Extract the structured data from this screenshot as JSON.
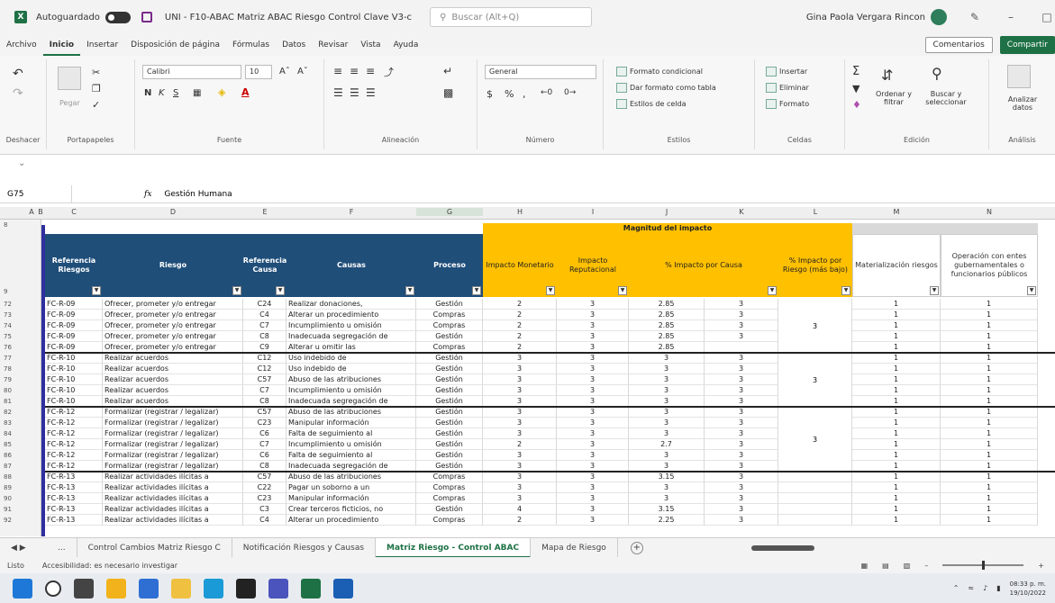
{
  "window": {
    "autosave_label": "Autoguardado",
    "doc_title": "UNI - F10-ABAC Matriz ABAC Riesgo Control Clave V3-c",
    "search_placeholder": "Buscar (Alt+Q)",
    "user_name": "Gina Paola Vergara Rincon"
  },
  "menu": {
    "tabs": [
      "Archivo",
      "Inicio",
      "Insertar",
      "Disposición de página",
      "Fórmulas",
      "Datos",
      "Revisar",
      "Vista",
      "Ayuda"
    ],
    "comments_label": "Comentarios",
    "share_label": "Compartir"
  },
  "ribbon": {
    "undo_label": "Deshacer",
    "clipboard_label": "Portapapeles",
    "paste_label": "Pegar",
    "font_name": "Calibri",
    "font_size": "10",
    "font_label": "Fuente",
    "alignment_label": "Alineación",
    "number_format": "General",
    "number_label": "Número",
    "cond_format": "Formato condicional",
    "format_table": "Dar formato como tabla",
    "cell_styles": "Estilos de celda",
    "styles_label": "Estilos",
    "insert": "Insertar",
    "delete": "Eliminar",
    "format": "Formato",
    "cells_label": "Celdas",
    "sort_filter": "Ordenar y filtrar",
    "find_select": "Buscar y seleccionar",
    "editing_label": "Edición",
    "analyze_data": "Analizar datos",
    "analysis_label": "Análisis"
  },
  "formula_bar": {
    "name_box": "G75",
    "fx": "fx",
    "value": "Gestión Humana"
  },
  "columns": [
    "A",
    "B",
    "C",
    "D",
    "E",
    "F",
    "G",
    "H",
    "I",
    "J",
    "K",
    "L",
    "M",
    "N"
  ],
  "headers": {
    "group_magnitud": "Magnitud del impacto",
    "ref_riesgo": "Referencia Riesgos",
    "riesgo": "Riesgo",
    "ref_causa": "Referencia Causa",
    "causas": "Causas",
    "proceso": "Proceso",
    "impacto_monetario": "Impacto Monetario",
    "impacto_reputacional": "Impacto Reputacional",
    "pct_impacto_causa": "% Impacto por Causa",
    "pct_impacto_riesgo": "% Impacto por Riesgo (más bajo)",
    "materializacion": "Materialización riesgos",
    "operacion_entes": "Operación con entes gubernamentales o funcionarios públicos",
    "header_row_num": "9"
  },
  "rows": [
    {
      "n": "72",
      "ref": "FC-R-09",
      "riesgo": "Ofrecer, prometer y/o entregar",
      "rc": "C24",
      "causa": "Realizar donaciones,",
      "proc": "Gestión",
      "im": "2",
      "ir": "3",
      "pc": "2.85",
      "k": "3",
      "m": "1",
      "o": "1"
    },
    {
      "n": "73",
      "ref": "FC-R-09",
      "riesgo": "Ofrecer, prometer y/o entregar",
      "rc": "C4",
      "causa": "Alterar un procedimiento",
      "proc": "Compras",
      "im": "2",
      "ir": "3",
      "pc": "2.85",
      "k": "3",
      "m": "1",
      "o": "1"
    },
    {
      "n": "74",
      "ref": "FC-R-09",
      "riesgo": "Ofrecer, prometer y/o entregar",
      "rc": "C7",
      "causa": "Incumplimiento u omisión",
      "proc": "Compras",
      "im": "2",
      "ir": "3",
      "pc": "2.85",
      "k": "3",
      "m": "1",
      "o": "1"
    },
    {
      "n": "75",
      "ref": "FC-R-09",
      "riesgo": "Ofrecer, prometer y/o entregar",
      "rc": "C8",
      "causa": "Inadecuada segregación de",
      "proc": "Gestión",
      "im": "2",
      "ir": "3",
      "pc": "2.85",
      "k": "3",
      "m": "1",
      "o": "1"
    },
    {
      "n": "76",
      "ref": "FC-R-09",
      "riesgo": "Ofrecer, prometer y/o entregar",
      "rc": "C9",
      "causa": "Alterar u omitir las",
      "proc": "Compras",
      "im": "2",
      "ir": "3",
      "pc": "2.85",
      "k": "",
      "m": "1",
      "o": "1"
    },
    {
      "n": "77",
      "ref": "FC-R-10",
      "riesgo": "Realizar acuerdos",
      "rc": "C12",
      "causa": "Uso indebido de",
      "proc": "Gestión",
      "im": "3",
      "ir": "3",
      "pc": "3",
      "k": "3",
      "m": "1",
      "o": "1"
    },
    {
      "n": "78",
      "ref": "FC-R-10",
      "riesgo": "Realizar acuerdos",
      "rc": "C12",
      "causa": "Uso indebido de",
      "proc": "Gestión",
      "im": "3",
      "ir": "3",
      "pc": "3",
      "k": "3",
      "m": "1",
      "o": "1"
    },
    {
      "n": "79",
      "ref": "FC-R-10",
      "riesgo": "Realizar acuerdos",
      "rc": "C57",
      "causa": "Abuso de las atribuciones",
      "proc": "Gestión",
      "im": "3",
      "ir": "3",
      "pc": "3",
      "k": "3",
      "m": "1",
      "o": "1"
    },
    {
      "n": "80",
      "ref": "FC-R-10",
      "riesgo": "Realizar acuerdos",
      "rc": "C7",
      "causa": "Incumplimiento u omisión",
      "proc": "Gestión",
      "im": "3",
      "ir": "3",
      "pc": "3",
      "k": "3",
      "m": "1",
      "o": "1"
    },
    {
      "n": "81",
      "ref": "FC-R-10",
      "riesgo": "Realizar acuerdos",
      "rc": "C8",
      "causa": "Inadecuada segregación de",
      "proc": "Gestión",
      "im": "3",
      "ir": "3",
      "pc": "3",
      "k": "3",
      "m": "1",
      "o": "1"
    },
    {
      "n": "82",
      "ref": "FC-R-12",
      "riesgo": "Formalizar (registrar / legalizar)",
      "rc": "C57",
      "causa": "Abuso de las atribuciones",
      "proc": "Gestión",
      "im": "3",
      "ir": "3",
      "pc": "3",
      "k": "3",
      "m": "1",
      "o": "1"
    },
    {
      "n": "83",
      "ref": "FC-R-12",
      "riesgo": "Formalizar (registrar / legalizar)",
      "rc": "C23",
      "causa": "Manipular información",
      "proc": "Gestión",
      "im": "3",
      "ir": "3",
      "pc": "3",
      "k": "3",
      "m": "1",
      "o": "1"
    },
    {
      "n": "84",
      "ref": "FC-R-12",
      "riesgo": "Formalizar (registrar / legalizar)",
      "rc": "C6",
      "causa": "Falta de seguimiento al",
      "proc": "Gestión",
      "im": "3",
      "ir": "3",
      "pc": "3",
      "k": "3",
      "m": "1",
      "o": "1"
    },
    {
      "n": "85",
      "ref": "FC-R-12",
      "riesgo": "Formalizar (registrar / legalizar)",
      "rc": "C7",
      "causa": "Incumplimiento u omisión",
      "proc": "Gestión",
      "im": "2",
      "ir": "3",
      "pc": "2.7",
      "k": "3",
      "m": "1",
      "o": "1"
    },
    {
      "n": "86",
      "ref": "FC-R-12",
      "riesgo": "Formalizar (registrar / legalizar)",
      "rc": "C6",
      "causa": "Falta de seguimiento al",
      "proc": "Gestión",
      "im": "3",
      "ir": "3",
      "pc": "3",
      "k": "3",
      "m": "1",
      "o": "1"
    },
    {
      "n": "87",
      "ref": "FC-R-12",
      "riesgo": "Formalizar (registrar / legalizar)",
      "rc": "C8",
      "causa": "Inadecuada segregación de",
      "proc": "Gestión",
      "im": "3",
      "ir": "3",
      "pc": "3",
      "k": "3",
      "m": "1",
      "o": "1"
    },
    {
      "n": "88",
      "ref": "FC-R-13",
      "riesgo": "Realizar actividades ilícitas a",
      "rc": "C57",
      "causa": "Abuso de las atribuciones",
      "proc": "Compras",
      "im": "3",
      "ir": "3",
      "pc": "3.15",
      "k": "3",
      "m": "1",
      "o": "1"
    },
    {
      "n": "89",
      "ref": "FC-R-13",
      "riesgo": "Realizar actividades ilícitas a",
      "rc": "C22",
      "causa": "Pagar un soborno a un",
      "proc": "Compras",
      "im": "3",
      "ir": "3",
      "pc": "3",
      "k": "3",
      "m": "1",
      "o": "1"
    },
    {
      "n": "90",
      "ref": "FC-R-13",
      "riesgo": "Realizar actividades ilícitas a",
      "rc": "C23",
      "causa": "Manipular información",
      "proc": "Compras",
      "im": "3",
      "ir": "3",
      "pc": "3",
      "k": "3",
      "m": "1",
      "o": "1"
    },
    {
      "n": "91",
      "ref": "FC-R-13",
      "riesgo": "Realizar actividades ilícitas a",
      "rc": "C3",
      "causa": "Crear terceros ficticios, no",
      "proc": "Gestión",
      "im": "4",
      "ir": "3",
      "pc": "3.15",
      "k": "3",
      "m": "1",
      "o": "1"
    },
    {
      "n": "92",
      "ref": "FC-R-13",
      "riesgo": "Realizar actividades ilícitas a",
      "rc": "C4",
      "causa": "Alterar un procedimiento",
      "proc": "Compras",
      "im": "2",
      "ir": "3",
      "pc": "2.25",
      "k": "3",
      "m": "1",
      "o": "1"
    }
  ],
  "merged_l": [
    {
      "row_start": 0,
      "row_span": 5,
      "value": "3"
    },
    {
      "row_start": 5,
      "row_span": 5,
      "value": "3"
    },
    {
      "row_start": 10,
      "row_span": 6,
      "value": "3"
    }
  ],
  "sheet_tabs": {
    "ellipsis": "...",
    "tabs": [
      "Control Cambios Matriz Riesgo C",
      "Notificación Riesgos y Causas",
      "Matriz Riesgo - Control ABAC",
      "Mapa de Riesgo"
    ],
    "active_index": 2
  },
  "status": {
    "ready": "Listo",
    "accessibility": "Accesibilidad: es necesario investigar"
  },
  "taskbar": {
    "time": "08:33 p. m.",
    "date": "19/10/2022"
  }
}
